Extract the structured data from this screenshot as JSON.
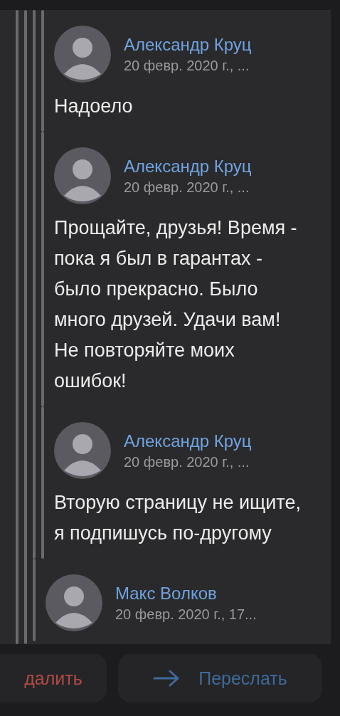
{
  "thread": [
    {
      "children": [
        {
          "author": "Александр Круц",
          "date": "20 февр. 2020 г., ...",
          "text": "Надоело"
        },
        {
          "author": "Александр Круц",
          "date": "20 февр. 2020 г., ...",
          "text": "Прощайте, друзья! Время - пока я был в гарантах - было прекрасно. Было много друзей. Удачи вам! Не повторяйте моих ошибок!"
        },
        {
          "author": "Александр Круц",
          "date": "20 февр. 2020 г., ...",
          "text": "Вторую страницу не ищите, я подпишусь по-другому"
        }
      ]
    },
    {
      "author": "Макс Волков",
      "date": "20 февр. 2020 г., 17..."
    }
  ],
  "actions": [
    {
      "kind": "delete",
      "label": "далить"
    },
    {
      "kind": "forward",
      "label": "Переслать"
    }
  ]
}
